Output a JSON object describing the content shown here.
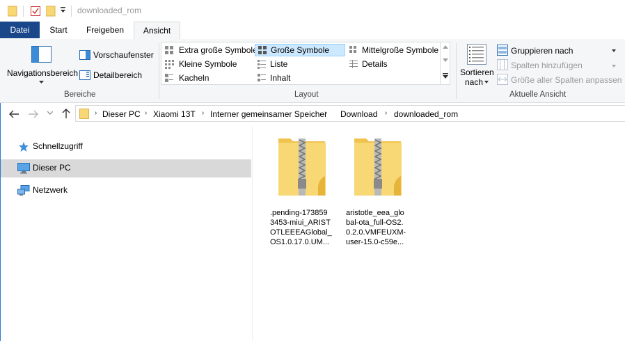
{
  "window": {
    "title": "downloaded_rom"
  },
  "tabs": [
    {
      "label": "Datei"
    },
    {
      "label": "Start"
    },
    {
      "label": "Freigeben"
    },
    {
      "label": "Ansicht"
    }
  ],
  "ribbon": {
    "bereiche": {
      "nav_pane_label": "Navigationsbereich",
      "preview_label": "Vorschaufenster",
      "details_label": "Detailbereich",
      "group_label": "Bereiche"
    },
    "layout": {
      "items": [
        "Extra große Symbole",
        "Große Symbole",
        "Mittelgroße Symbole",
        "Kleine Symbole",
        "Liste",
        "Details",
        "Kacheln",
        "Inhalt"
      ],
      "selected": "Große Symbole",
      "group_label": "Layout"
    },
    "aktuelle_ansicht": {
      "sort_label_1": "Sortieren",
      "sort_label_2": "nach",
      "group_by": "Gruppieren nach",
      "add_columns": "Spalten hinzufügen",
      "size_columns": "Größe aller Spalten anpassen",
      "group_label": "Aktuelle Ansicht"
    }
  },
  "address": {
    "crumbs": [
      "Dieser PC",
      "Xiaomi 13T",
      "Interner gemeinsamer Speicher",
      "Download",
      "downloaded_rom"
    ]
  },
  "nav": {
    "items": [
      {
        "label": "Schnellzugriff",
        "icon": "star-icon"
      },
      {
        "label": "Dieser PC",
        "icon": "computer-icon",
        "selected": true
      },
      {
        "label": "Netzwerk",
        "icon": "network-icon"
      }
    ]
  },
  "files": [
    {
      "name_lines": [
        ".pending-173859",
        "3453-miui_ARIST",
        "OTLEEEAGlobal_",
        "OS1.0.17.0.UM..."
      ],
      "icon": "zip-folder-icon"
    },
    {
      "name_lines": [
        "aristotle_eea_glo",
        "bal-ota_full-OS2.",
        "0.2.0.VMFEUXM-",
        "user-15.0-c59e..."
      ],
      "icon": "zip-folder-icon"
    }
  ],
  "colors": {
    "file_tab": "#19478a",
    "selected_layout": "#cce8ff",
    "folder": "#f8d775"
  }
}
